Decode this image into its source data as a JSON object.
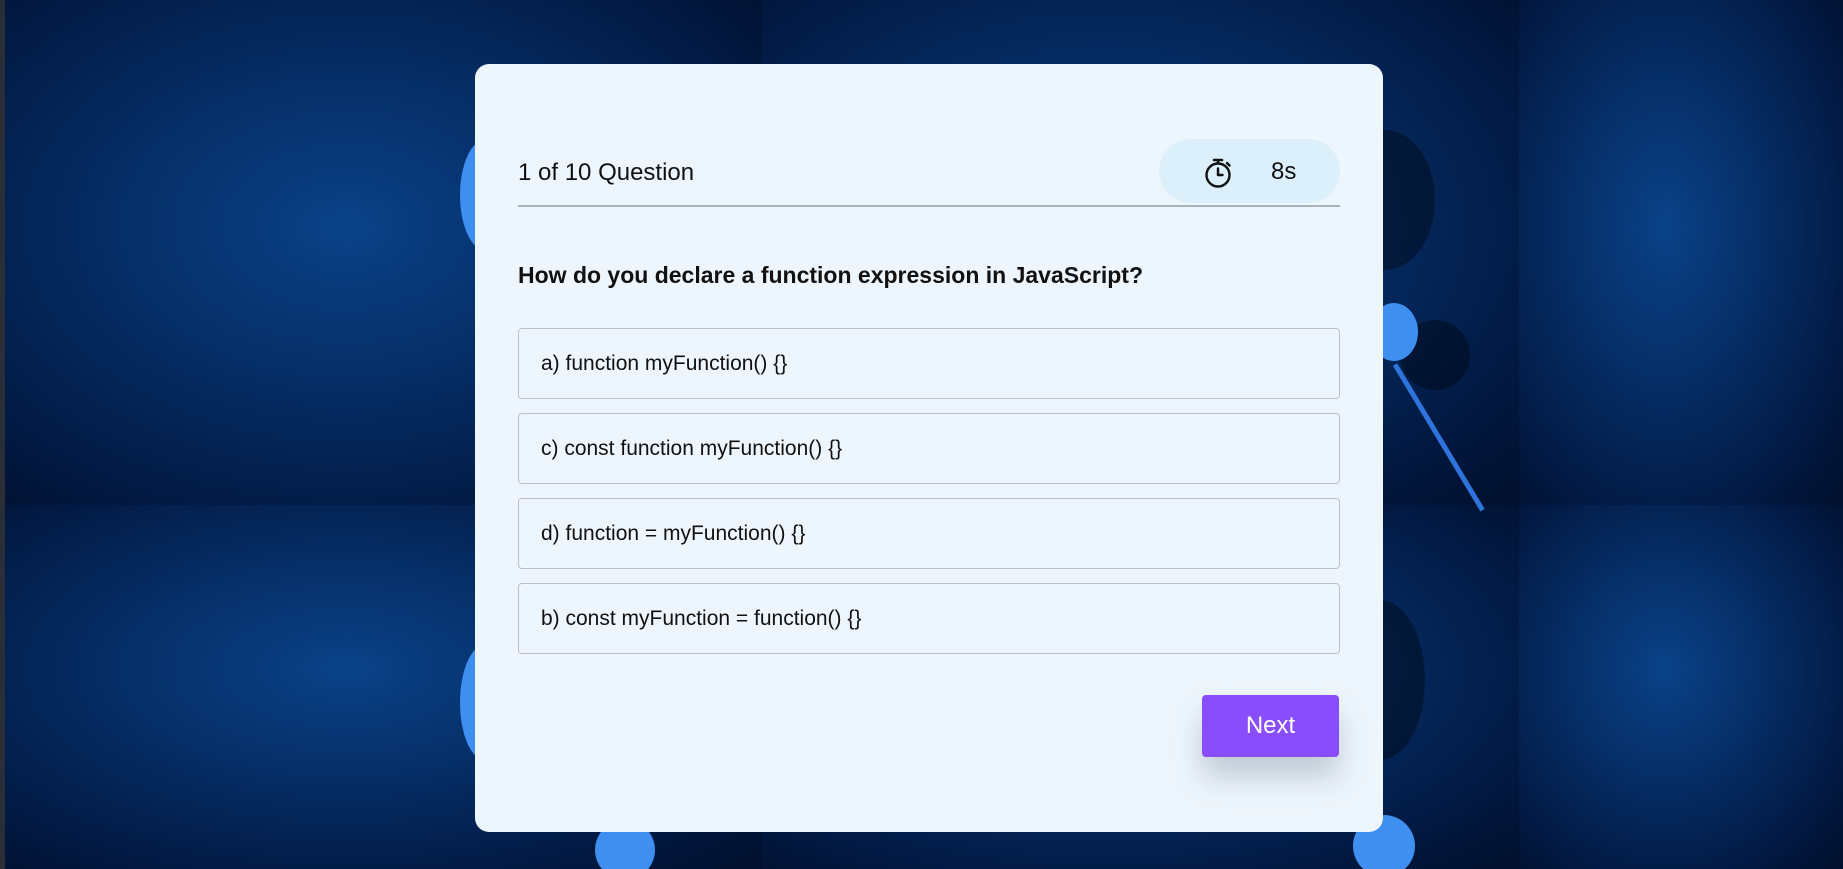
{
  "quiz": {
    "counter": "1 of 10 Question",
    "timer": "8s",
    "question": "How do you declare a function expression in JavaScript?",
    "options": [
      {
        "label": "a) function myFunction() {}"
      },
      {
        "label": "c) const function myFunction() {}"
      },
      {
        "label": "d) function = myFunction() {}"
      },
      {
        "label": "b) const myFunction = function() {}"
      }
    ],
    "next_label": "Next"
  },
  "icons": {
    "timer": "stopwatch-icon"
  },
  "colors": {
    "accent": "#8a4dfb",
    "card_background": "#eef6fd",
    "timer_pill": "#dbf0fb",
    "page_background": "#03163a"
  }
}
